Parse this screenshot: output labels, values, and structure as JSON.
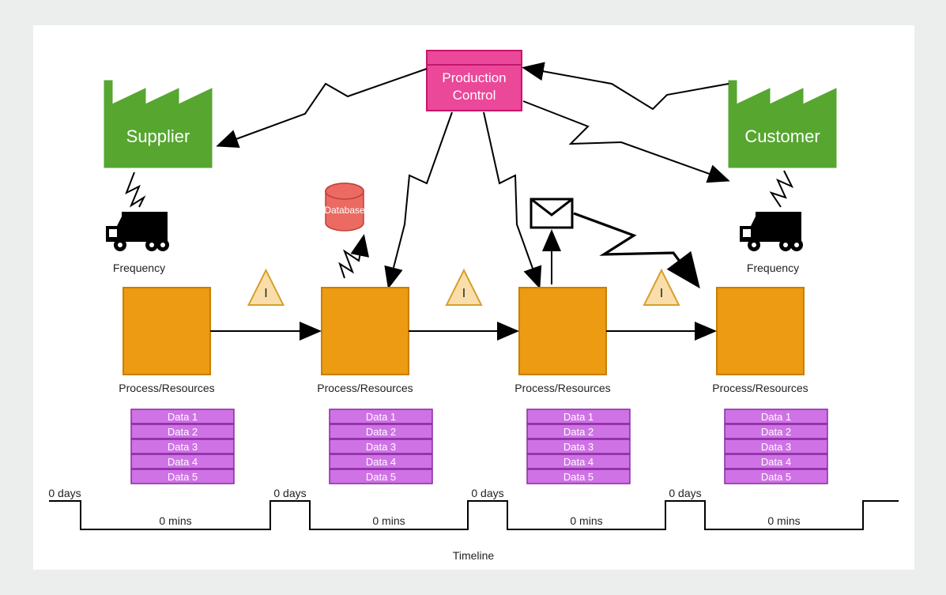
{
  "productionControl": {
    "title1": "Production",
    "title2": "Control"
  },
  "supplier": {
    "label": "Supplier",
    "frequency": "Frequency"
  },
  "customer": {
    "label": "Customer",
    "frequency": "Frequency"
  },
  "database": {
    "label": "Database"
  },
  "inventory": {
    "label": "I"
  },
  "processes": [
    {
      "name": "Process/Resources",
      "data": [
        "Data 1",
        "Data 2",
        "Data 3",
        "Data 4",
        "Data 5"
      ]
    },
    {
      "name": "Process/Resources",
      "data": [
        "Data 1",
        "Data 2",
        "Data 3",
        "Data 4",
        "Data 5"
      ]
    },
    {
      "name": "Process/Resources",
      "data": [
        "Data 1",
        "Data 2",
        "Data 3",
        "Data 4",
        "Data 5"
      ]
    },
    {
      "name": "Process/Resources",
      "data": [
        "Data 1",
        "Data 2",
        "Data 3",
        "Data 4",
        "Data 5"
      ]
    }
  ],
  "timeline": {
    "up": [
      "0 days",
      "0 days",
      "0 days",
      "0 days"
    ],
    "down": [
      "0 mins",
      "0 mins",
      "0 mins",
      "0 mins"
    ],
    "label": "Timeline"
  }
}
